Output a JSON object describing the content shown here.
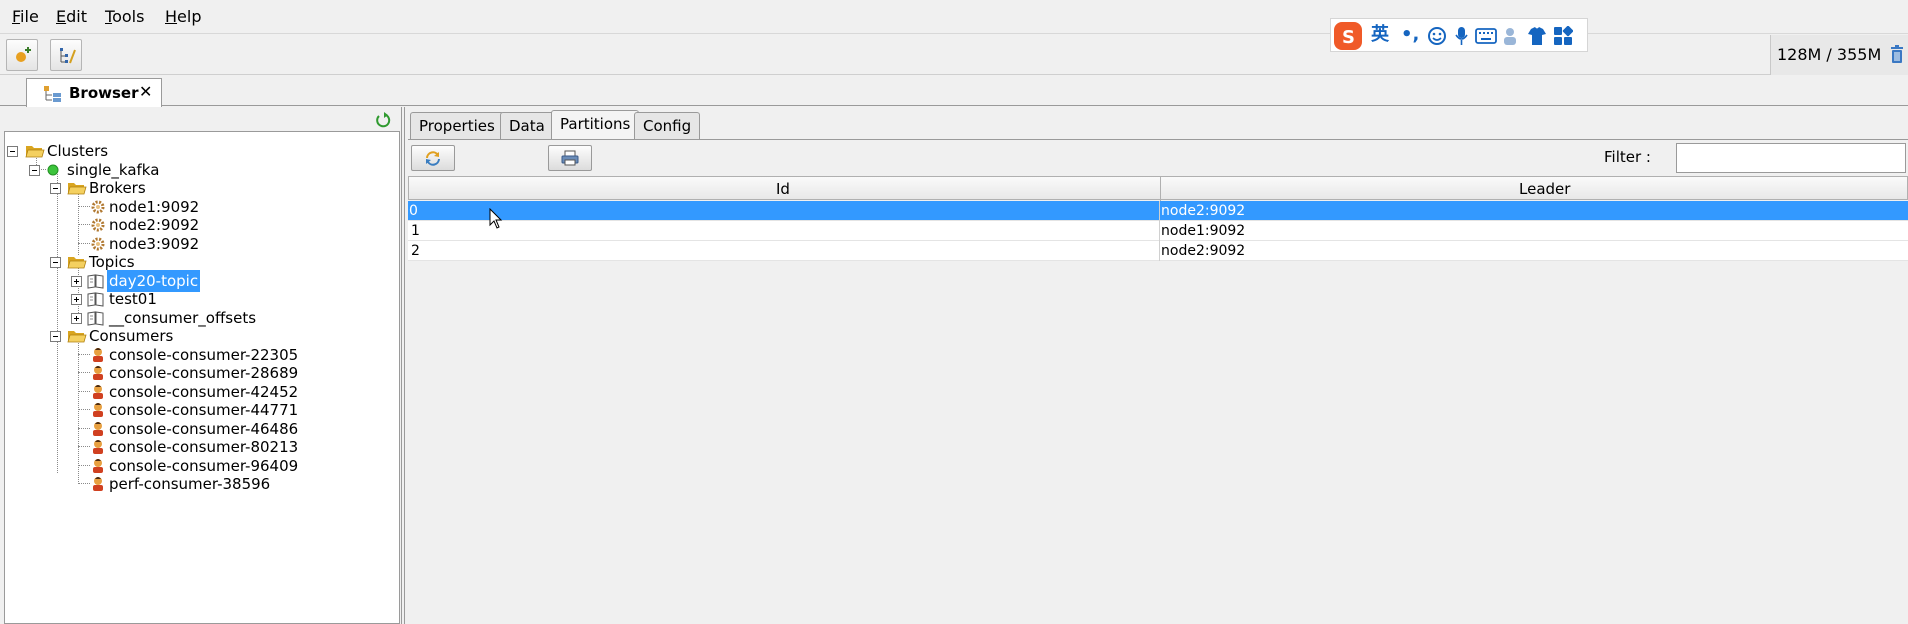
{
  "menu": {
    "file": {
      "mnemonic": "F",
      "rest": "ile"
    },
    "edit": {
      "mnemonic": "E",
      "rest": "dit"
    },
    "tools": {
      "mnemonic": "T",
      "rest": "ools"
    },
    "help": {
      "mnemonic": "H",
      "rest": "elp"
    }
  },
  "memory": {
    "text": "128M / 355M"
  },
  "ime": {
    "lang_char": "英",
    "punct": "•,"
  },
  "main_tab": {
    "label": "Browser",
    "close": "✕"
  },
  "tree": {
    "root": "Clusters",
    "cluster": "single_kafka",
    "brokers_label": "Brokers",
    "brokers": [
      "node1:9092",
      "node2:9092",
      "node3:9092"
    ],
    "topics_label": "Topics",
    "topics": [
      "day20-topic",
      "test01",
      "__consumer_offsets"
    ],
    "selected_topic": "day20-topic",
    "consumers_label": "Consumers",
    "consumers": [
      "console-consumer-22305",
      "console-consumer-28689",
      "console-consumer-42452",
      "console-consumer-44771",
      "console-consumer-46486",
      "console-consumer-80213",
      "console-consumer-96409",
      "perf-consumer-38596"
    ]
  },
  "subtabs": [
    "Properties",
    "Data",
    "Partitions",
    "Config"
  ],
  "active_subtab": "Partitions",
  "filter": {
    "label": "Filter :",
    "value": ""
  },
  "table": {
    "columns": [
      "Id",
      "Leader"
    ],
    "rows": [
      {
        "id": "0",
        "leader": "node2:9092"
      },
      {
        "id": "1",
        "leader": "node1:9092"
      },
      {
        "id": "2",
        "leader": "node2:9092"
      }
    ],
    "selected_row": 0
  },
  "colors": {
    "selection": "#3399ff",
    "folder": "#e8c24a",
    "status_ok": "#3cc43c"
  }
}
